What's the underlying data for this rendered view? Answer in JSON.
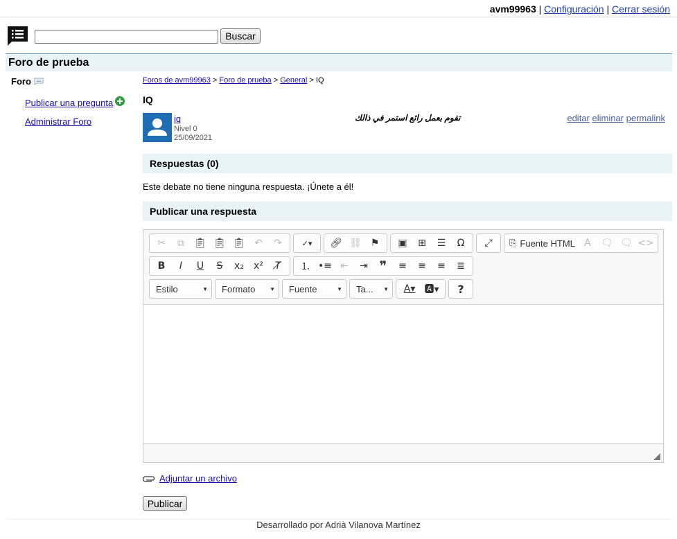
{
  "header": {
    "username": "avm99963",
    "separator": "|",
    "settings_link": "Configuración",
    "logout_link": "Cerrar sesión",
    "search_button": "Buscar"
  },
  "forum": {
    "title": "Foro de prueba"
  },
  "sidebar": {
    "title": "Foro",
    "links": [
      "Publicar una pregunta",
      "Administrar Foro"
    ]
  },
  "breadcrumb": {
    "items": [
      "Foros de avm99963",
      "Foro de prueba",
      "General"
    ],
    "separator": ">",
    "current": "IQ"
  },
  "thread": {
    "title": "IQ",
    "post": {
      "author": "iq",
      "level": "Nivel 0",
      "date": "25/09/2021",
      "text": "تقوم بعمل رائع استمر في ذالك",
      "actions": [
        "editar",
        "eliminar",
        "permalink"
      ]
    }
  },
  "replies": {
    "header": "Respuestas (0)",
    "empty_text": "Este debate no tiene ninguna respuesta. ¡Únete a él!"
  },
  "reply_form": {
    "header": "Publicar una respuesta",
    "source_button": "Fuente HTML",
    "combos": [
      "Estilo",
      "Formato",
      "Fuente",
      "Ta..."
    ],
    "attach_link": "Adjuntar un archivo",
    "submit": "Publicar"
  },
  "footer": {
    "text": "Desarrollado por Adrià Vilanova Martínez"
  },
  "colors": {
    "accent_bar": "#e7f3f7",
    "link": "#1a0dab",
    "avatar_bg": "#1f6db5",
    "plus_icon": "#2e9b3e"
  }
}
